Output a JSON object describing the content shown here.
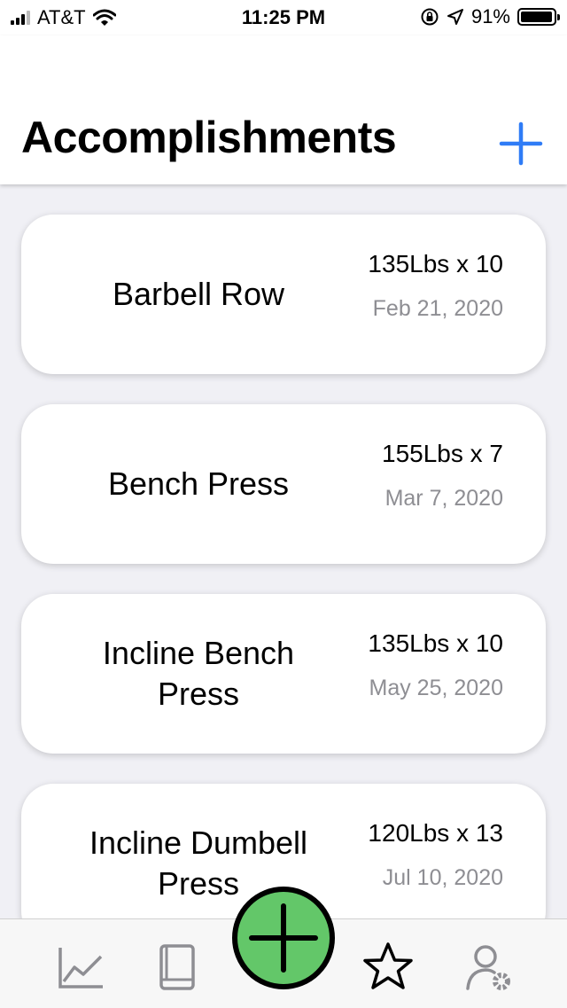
{
  "status_bar": {
    "carrier": "AT&T",
    "time": "11:25 PM",
    "battery": "91%",
    "icons": [
      "signal-icon",
      "wifi-icon",
      "orientation-lock-icon",
      "location-icon",
      "battery-icon"
    ]
  },
  "header": {
    "title": "Accomplishments",
    "add_icon": "plus-icon",
    "accent_color": "#2f7cf6"
  },
  "accomplishments": [
    {
      "name": "Barbell Row",
      "weight": "135Lbs x 10",
      "date": "Feb 21, 2020"
    },
    {
      "name": "Bench Press",
      "weight": "155Lbs x 7",
      "date": "Mar 7, 2020"
    },
    {
      "name": "Incline Bench Press",
      "weight": "135Lbs x 10",
      "date": "May 25, 2020"
    },
    {
      "name": "Incline Dumbell Press",
      "weight": "120Lbs x 13",
      "date": "Jul 10, 2020"
    }
  ],
  "tab_bar": {
    "tabs": [
      {
        "icon": "line-chart-icon",
        "active": false
      },
      {
        "icon": "book-icon",
        "active": false
      },
      {
        "icon": "plus-icon",
        "active": false
      },
      {
        "icon": "star-icon",
        "active": true
      },
      {
        "icon": "user-settings-icon",
        "active": false
      }
    ],
    "fab_color": "#63c769"
  }
}
